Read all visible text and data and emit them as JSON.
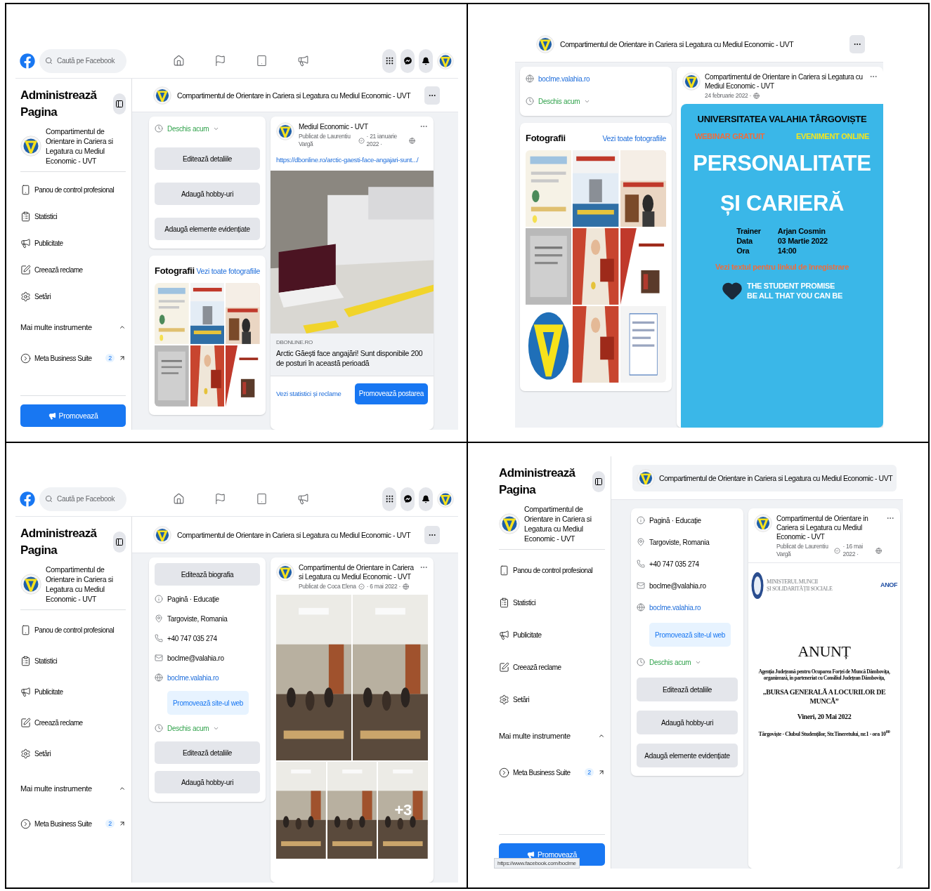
{
  "panels": [
    {
      "topbar": {
        "search": {
          "placeholder": "Caută pe Facebook"
        }
      },
      "sidebar": {
        "title": "Administrează Pagina",
        "page_name": "Compartimentul de Orientare in Cariera si Legatura cu Mediul Economic - UVT",
        "items": [
          {
            "kind": "dashboard",
            "label": "Panou de control profesional"
          },
          {
            "kind": "insights",
            "label": "Statistici"
          },
          {
            "kind": "ads",
            "label": "Publicitate"
          },
          {
            "kind": "create",
            "label": "Creează reclame"
          },
          {
            "kind": "settings",
            "label": "Setări"
          }
        ],
        "more_tools": {
          "label": "Mai multe instrumente",
          "expanded": true
        },
        "suite": {
          "label": "Meta Business Suite",
          "badge": "2"
        },
        "promote": "Promovează"
      },
      "header": {
        "kind": "bar",
        "title": "Compartimentul de Orientare in Cariera si Legatura cu Mediul Economic - UVT"
      },
      "about": {
        "items": [
          {
            "kind": "hours",
            "label": "Deschis acum"
          },
          {
            "kind": "button",
            "label": "Editează detaliile"
          },
          {
            "kind": "button",
            "label": "Adaugă hobby-uri"
          },
          {
            "kind": "button",
            "label": "Adaugă elemente evidențiate"
          }
        ]
      },
      "photos": {
        "title": "Fotografii",
        "link": "Vezi toate fotografiile"
      },
      "post": {
        "author": "Mediul Economic - UVT",
        "byline": "Publicat de Laurentiu Vargă",
        "date": "· 21 ianuarie 2022 ·",
        "content": {
          "kind": "link_preview",
          "url": "https://dbonline.ro/arctic-gaesti-face-angajari-sunt.../",
          "domain": "DBONLINE.RO",
          "title": "Arctic Găești face angajări! Sunt disponibile 200 de posturi în această perioadă",
          "footer_link": "Vezi statistici și reclame",
          "button": "Promovează postarea"
        }
      }
    },
    {
      "header": {
        "kind": "bar",
        "title": "Compartimentul de Orientare in Cariera si Legatura cu Mediul Economic - UVT"
      },
      "about": {
        "items": [
          {
            "kind": "website",
            "label": "boclme.valahia.ro"
          },
          {
            "kind": "hours",
            "label": "Deschis acum"
          }
        ]
      },
      "photos": {
        "title": "Fotografii",
        "link": "Vezi toate fotografiile"
      },
      "post": {
        "author": "Compartimentul de Orientare in Cariera si Legatura cu Mediul Economic - UVT",
        "date": "24 februarie 2022 ·",
        "content": {
          "kind": "poster",
          "heading": "UNIVERSITATEA VALAHIA TÂRGOVIȘTE",
          "tags": [
            {
              "label": "WEBINAR GRATUIT",
              "color": "#f26b3a"
            },
            {
              "label": "EVENIMENT ONLINE",
              "color": "#f5e61c"
            }
          ],
          "title_lines": [
            "PERSONALITATE",
            "ȘI CARIERĂ"
          ],
          "details": [
            {
              "label": "Trainer",
              "value": "Arjan Cosmin"
            },
            {
              "label": "Data",
              "value": "03 Martie 2022"
            },
            {
              "label": "Ora",
              "value": "14:00"
            }
          ],
          "cta": "Vezi textul pentru linkul de înregistrare",
          "brand_lines": [
            "THE STUDENT PROMISE",
            "BE ALL THAT YOU CAN BE"
          ]
        }
      }
    },
    {
      "topbar": {
        "search": {
          "placeholder": "Caută pe Facebook"
        }
      },
      "sidebar": {
        "title": "Administrează Pagina",
        "page_name": "Compartimentul de Orientare in Cariera si Legatura cu Mediul Economic - UVT",
        "items": [
          {
            "kind": "dashboard",
            "label": "Panou de control profesional"
          },
          {
            "kind": "insights",
            "label": "Statistici"
          },
          {
            "kind": "ads",
            "label": "Publicitate"
          },
          {
            "kind": "create",
            "label": "Creează reclame"
          },
          {
            "kind": "settings",
            "label": "Setări"
          }
        ],
        "more_tools": {
          "label": "Mai multe instrumente",
          "expanded": true
        },
        "suite": {
          "label": "Meta Business Suite",
          "badge": "2"
        }
      },
      "header": {
        "kind": "bar",
        "title": "Compartimentul de Orientare in Cariera si Legatura cu Mediul Economic - UVT"
      },
      "about": {
        "items": [
          {
            "kind": "button",
            "label": "Editează biografia"
          },
          {
            "kind": "category",
            "label": "Pagină · Educație"
          },
          {
            "kind": "location",
            "label": "Targoviste, Romania"
          },
          {
            "kind": "phone",
            "label": "+40 747 035 274"
          },
          {
            "kind": "email",
            "label": "boclme@valahia.ro"
          },
          {
            "kind": "website",
            "label": "boclme.valahia.ro"
          },
          {
            "kind": "promote",
            "label": "Promovează site-ul web"
          },
          {
            "kind": "hours",
            "label": "Deschis acum"
          },
          {
            "kind": "button",
            "label": "Editează detaliile"
          },
          {
            "kind": "button",
            "label": "Adaugă hobby-uri"
          }
        ]
      },
      "post": {
        "author": "Compartimentul de Orientare in Cariera si Legatura cu Mediul Economic - UVT",
        "byline": "Publicat de Coca Elena",
        "date": "· 6 mai 2022 ·",
        "content": {
          "kind": "photo_grid",
          "more": "+3"
        }
      }
    },
    {
      "sidebar": {
        "title": "Administrează Pagina",
        "page_name": "Compartimentul de Orientare in Cariera si Legatura cu Mediul Economic - UVT",
        "items": [
          {
            "kind": "dashboard",
            "label": "Panou de control profesional"
          },
          {
            "kind": "insights",
            "label": "Statistici"
          },
          {
            "kind": "ads",
            "label": "Publicitate"
          },
          {
            "kind": "create",
            "label": "Creează reclame"
          },
          {
            "kind": "settings",
            "label": "Setări"
          }
        ],
        "more_tools": {
          "label": "Mai multe instrumente",
          "expanded": true
        },
        "suite": {
          "label": "Meta Business Suite",
          "badge": "2"
        },
        "promote": "Promovează"
      },
      "header": {
        "kind": "chip",
        "title": "Compartimentul de Orientare in Cariera si Legatura cu Mediul Economic - UVT"
      },
      "about": {
        "items": [
          {
            "kind": "category",
            "label": "Pagină · Educație"
          },
          {
            "kind": "location",
            "label": "Targoviste, Romania"
          },
          {
            "kind": "phone",
            "label": "+40 747 035 274"
          },
          {
            "kind": "email",
            "label": "boclme@valahia.ro"
          },
          {
            "kind": "website",
            "label": "boclme.valahia.ro"
          },
          {
            "kind": "promote",
            "label": "Promovează site-ul web"
          },
          {
            "kind": "hours",
            "label": "Deschis acum"
          },
          {
            "kind": "button",
            "label": "Editează detaliile"
          },
          {
            "kind": "button",
            "label": "Adaugă hobby-uri"
          },
          {
            "kind": "button",
            "label": "Adaugă elemente evidențiate"
          }
        ]
      },
      "post": {
        "author": "Compartimentul de Orientare in Cariera si Legatura cu Mediul Economic - UVT",
        "byline": "Publicat de Laurentiu Vargă",
        "date": "· 16 mai 2022 ·",
        "content": {
          "kind": "document",
          "ministry_lines": [
            "MINISTERUL MUNCII",
            "ȘI SOLIDARITĂȚII SOCIALE"
          ],
          "agency": "ANOF",
          "heading": "ANUNȚ",
          "lines": [
            "Agenția Județeană pentru Ocuparea Forței de Muncă Dâmbovița,",
            "organizează, în parteneriat cu Consiliul Județean Dâmbovița,"
          ],
          "event": "„BURSA GENERALĂ A LOCURILOR DE MUNCĂ”",
          "date": "Vineri, 20 Mai 2022",
          "place": "Târgoviște - Clubul Studenților, Str.Tineretului, nr.1 - ora 10$^{00}$"
        }
      },
      "status_url": "https://www.facebook.com/boclme"
    }
  ]
}
